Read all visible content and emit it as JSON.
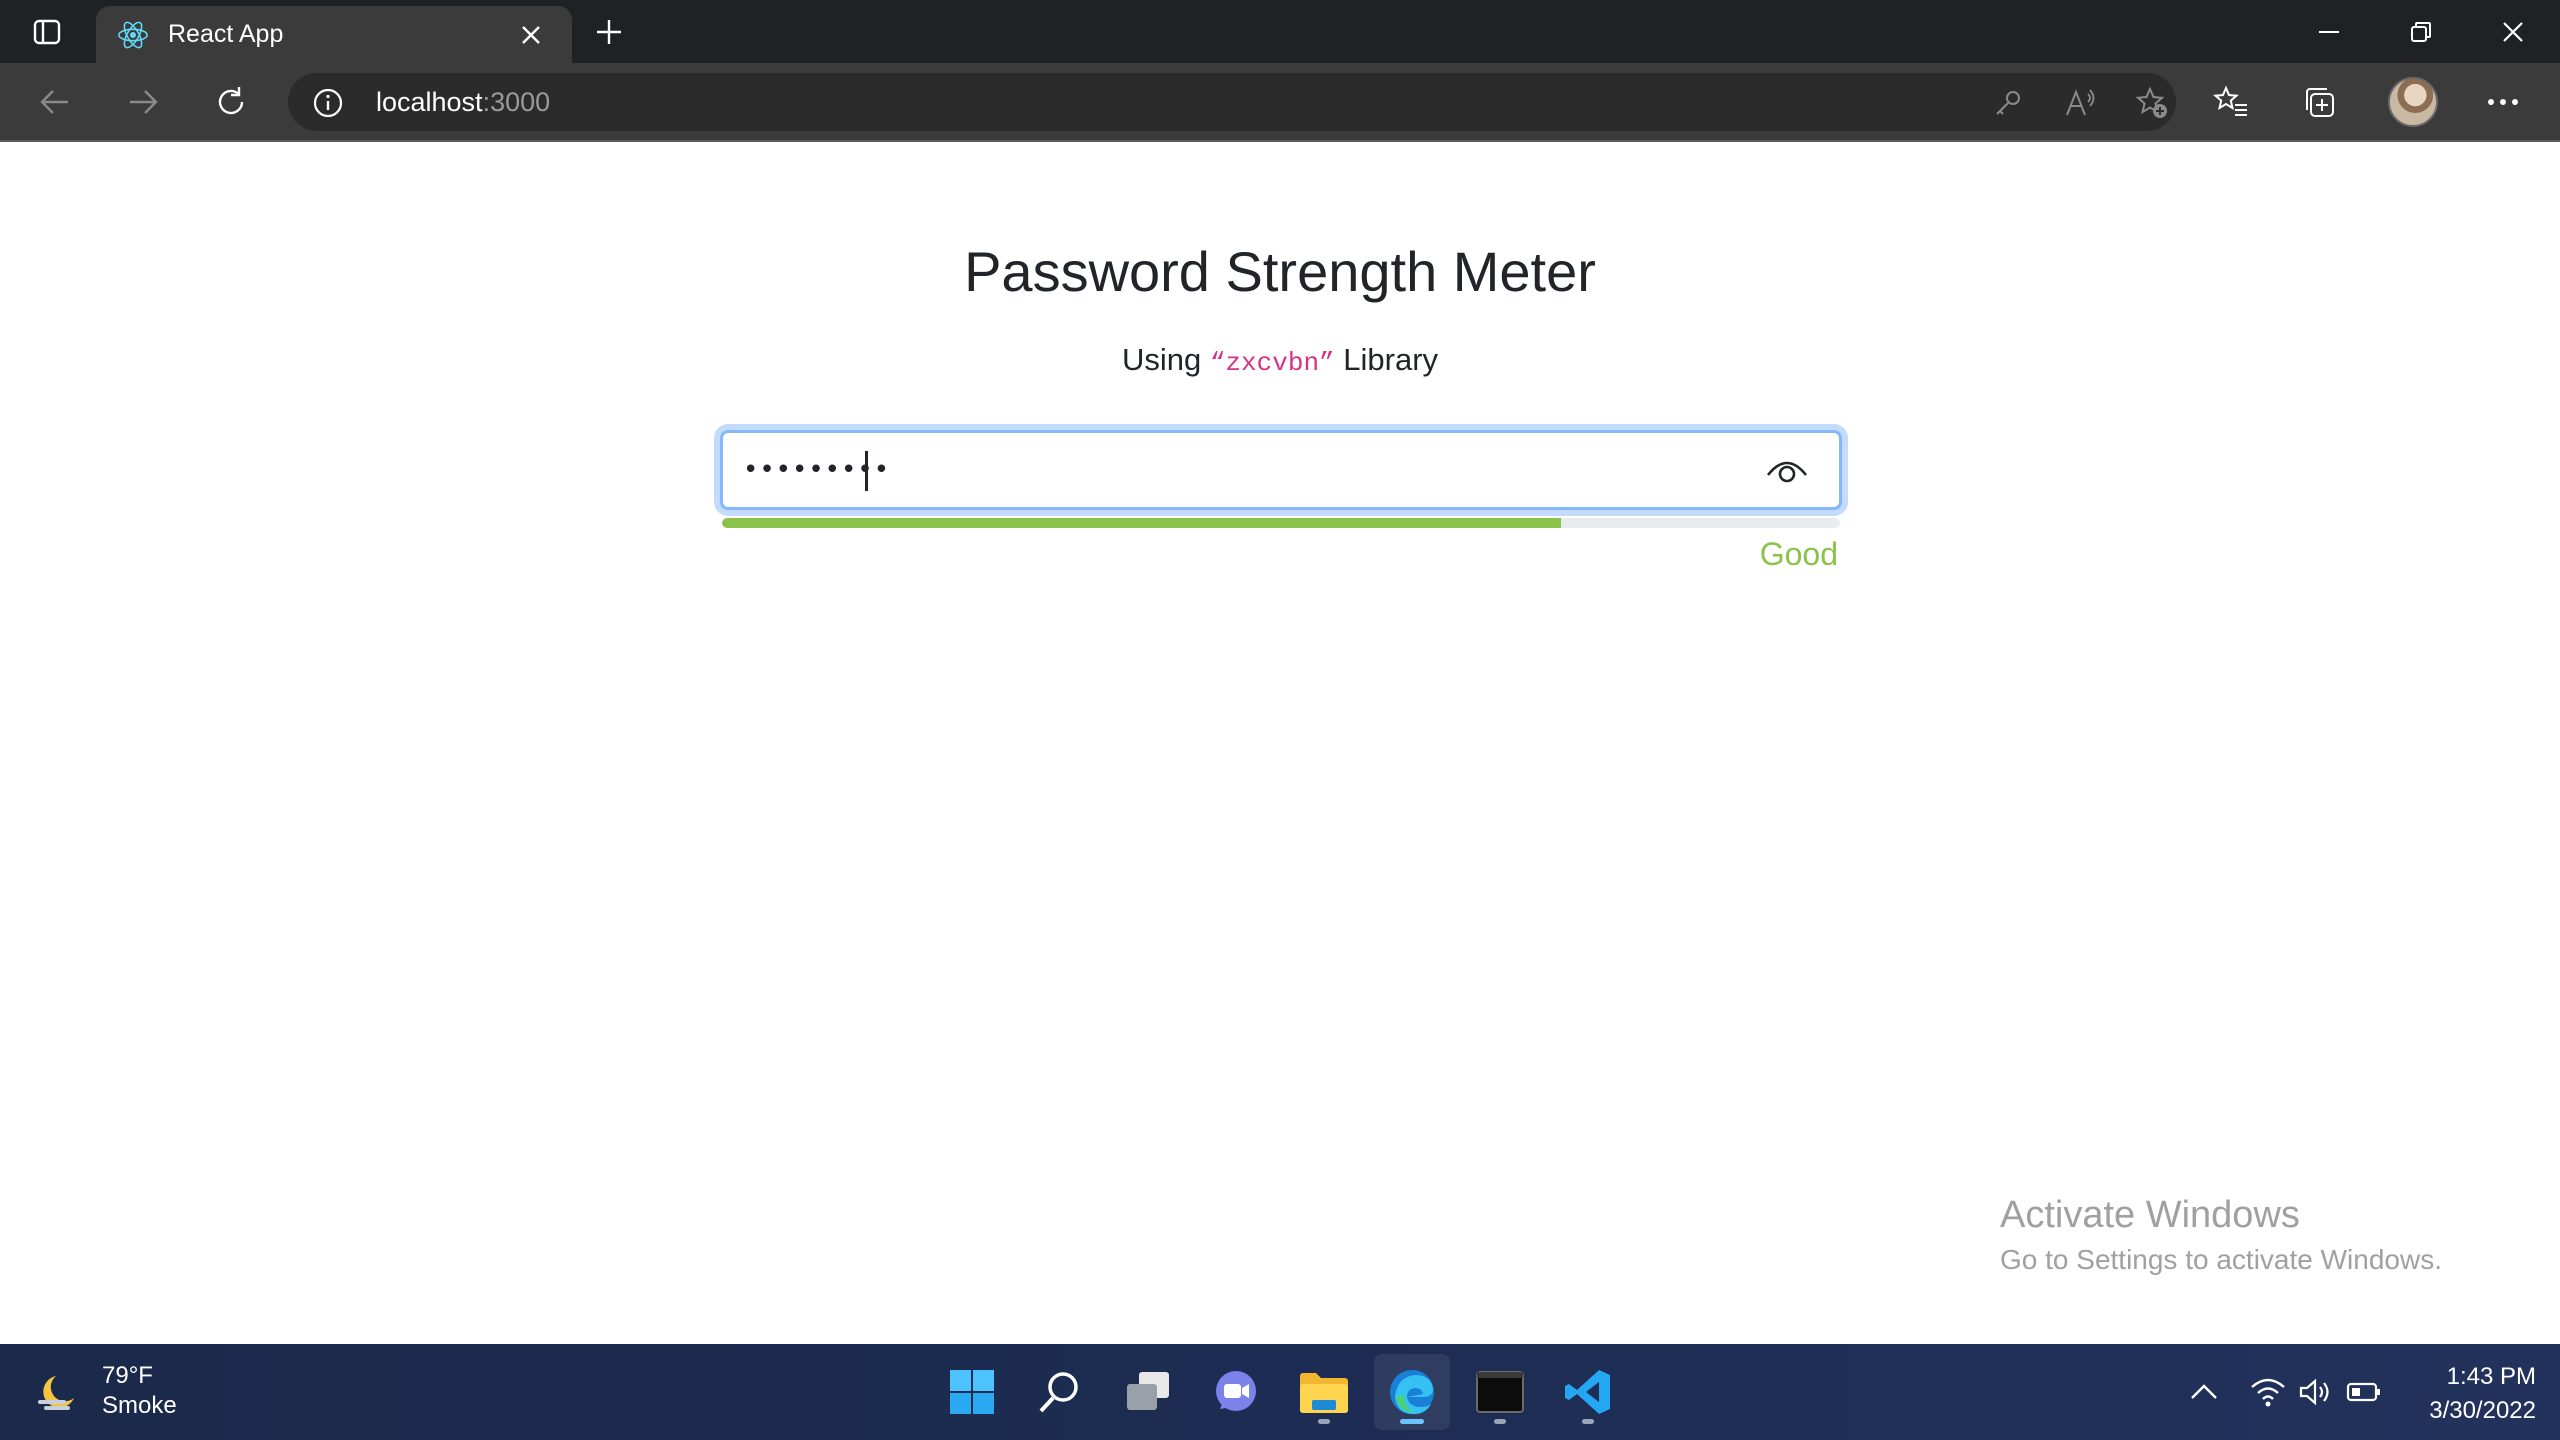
{
  "browser": {
    "tab": {
      "title": "React App",
      "favicon": "react-logo-icon"
    },
    "address": {
      "host": "localhost",
      "port": ":3000"
    },
    "icons": {
      "tab_actions": "tab-actions-icon",
      "new_tab": "plus-icon",
      "back": "back-arrow-icon",
      "forward": "forward-arrow-icon",
      "refresh": "refresh-icon",
      "site_info": "info-icon",
      "passwords": "key-icon",
      "read_aloud": "read-aloud-icon",
      "add_favorite": "star-plus-icon",
      "favorites": "favorites-icon",
      "collections": "collections-icon",
      "more": "ellipsis-icon"
    }
  },
  "page": {
    "title": "Password Strength Meter",
    "subtitle_prefix": "Using",
    "subtitle_code": "“zxcvbn”",
    "subtitle_suffix": "Library",
    "password": {
      "masked_value": "•••••••••",
      "toggle_icon": "eye-icon"
    },
    "strength": {
      "label": "Good",
      "fraction": 0.75,
      "color": "#8bc34a"
    }
  },
  "watermark": {
    "title": "Activate Windows",
    "subtitle": "Go to Settings to activate Windows."
  },
  "taskbar": {
    "weather": {
      "temperature": "79°F",
      "condition": "Smoke"
    },
    "apps": [
      "start-icon",
      "search-icon",
      "task-view-icon",
      "chat-icon",
      "file-explorer-icon",
      "edge-icon",
      "terminal-icon",
      "vscode-icon"
    ],
    "clock": {
      "time": "1:43 PM",
      "date": "3/30/2022"
    }
  },
  "colors": {
    "tabstrip": "#202124",
    "toolbar": "#3b3b3b",
    "focus_border": "#86b7fe",
    "code_pink": "#d63384",
    "good_green": "#8bc34a"
  }
}
